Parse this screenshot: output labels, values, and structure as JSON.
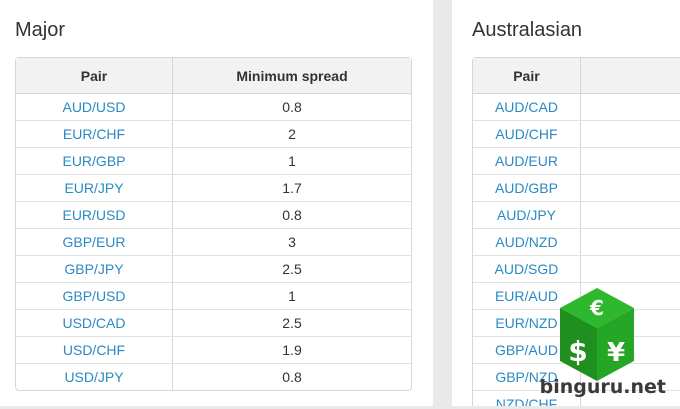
{
  "major": {
    "title": "Major",
    "headers": {
      "pair": "Pair",
      "spread": "Minimum spread"
    },
    "rows": [
      {
        "pair": "AUD/USD",
        "spread": "0.8"
      },
      {
        "pair": "EUR/CHF",
        "spread": "2"
      },
      {
        "pair": "EUR/GBP",
        "spread": "1"
      },
      {
        "pair": "EUR/JPY",
        "spread": "1.7"
      },
      {
        "pair": "EUR/USD",
        "spread": "0.8"
      },
      {
        "pair": "GBP/EUR",
        "spread": "3"
      },
      {
        "pair": "GBP/JPY",
        "spread": "2.5"
      },
      {
        "pair": "GBP/USD",
        "spread": "1"
      },
      {
        "pair": "USD/CAD",
        "spread": "2.5"
      },
      {
        "pair": "USD/CHF",
        "spread": "1.9"
      },
      {
        "pair": "USD/JPY",
        "spread": "0.8"
      }
    ]
  },
  "australasian": {
    "title": "Australasian",
    "headers": {
      "pair": "Pair"
    },
    "rows": [
      {
        "pair": "AUD/CAD"
      },
      {
        "pair": "AUD/CHF"
      },
      {
        "pair": "AUD/EUR"
      },
      {
        "pair": "AUD/GBP"
      },
      {
        "pair": "AUD/JPY"
      },
      {
        "pair": "AUD/NZD"
      },
      {
        "pair": "AUD/SGD"
      },
      {
        "pair": "EUR/AUD"
      },
      {
        "pair": "EUR/NZD"
      },
      {
        "pair": "GBP/AUD"
      },
      {
        "pair": "GBP/NZD"
      },
      {
        "pair": "NZD/CHF"
      }
    ]
  },
  "watermark": {
    "text": "binguru.net",
    "symbols": {
      "euro": "€",
      "dollar": "$",
      "yen": "¥"
    },
    "colors": {
      "cube_top": "#2eb82e",
      "cube_left": "#1f8f1f",
      "cube_right": "#26a626"
    }
  }
}
